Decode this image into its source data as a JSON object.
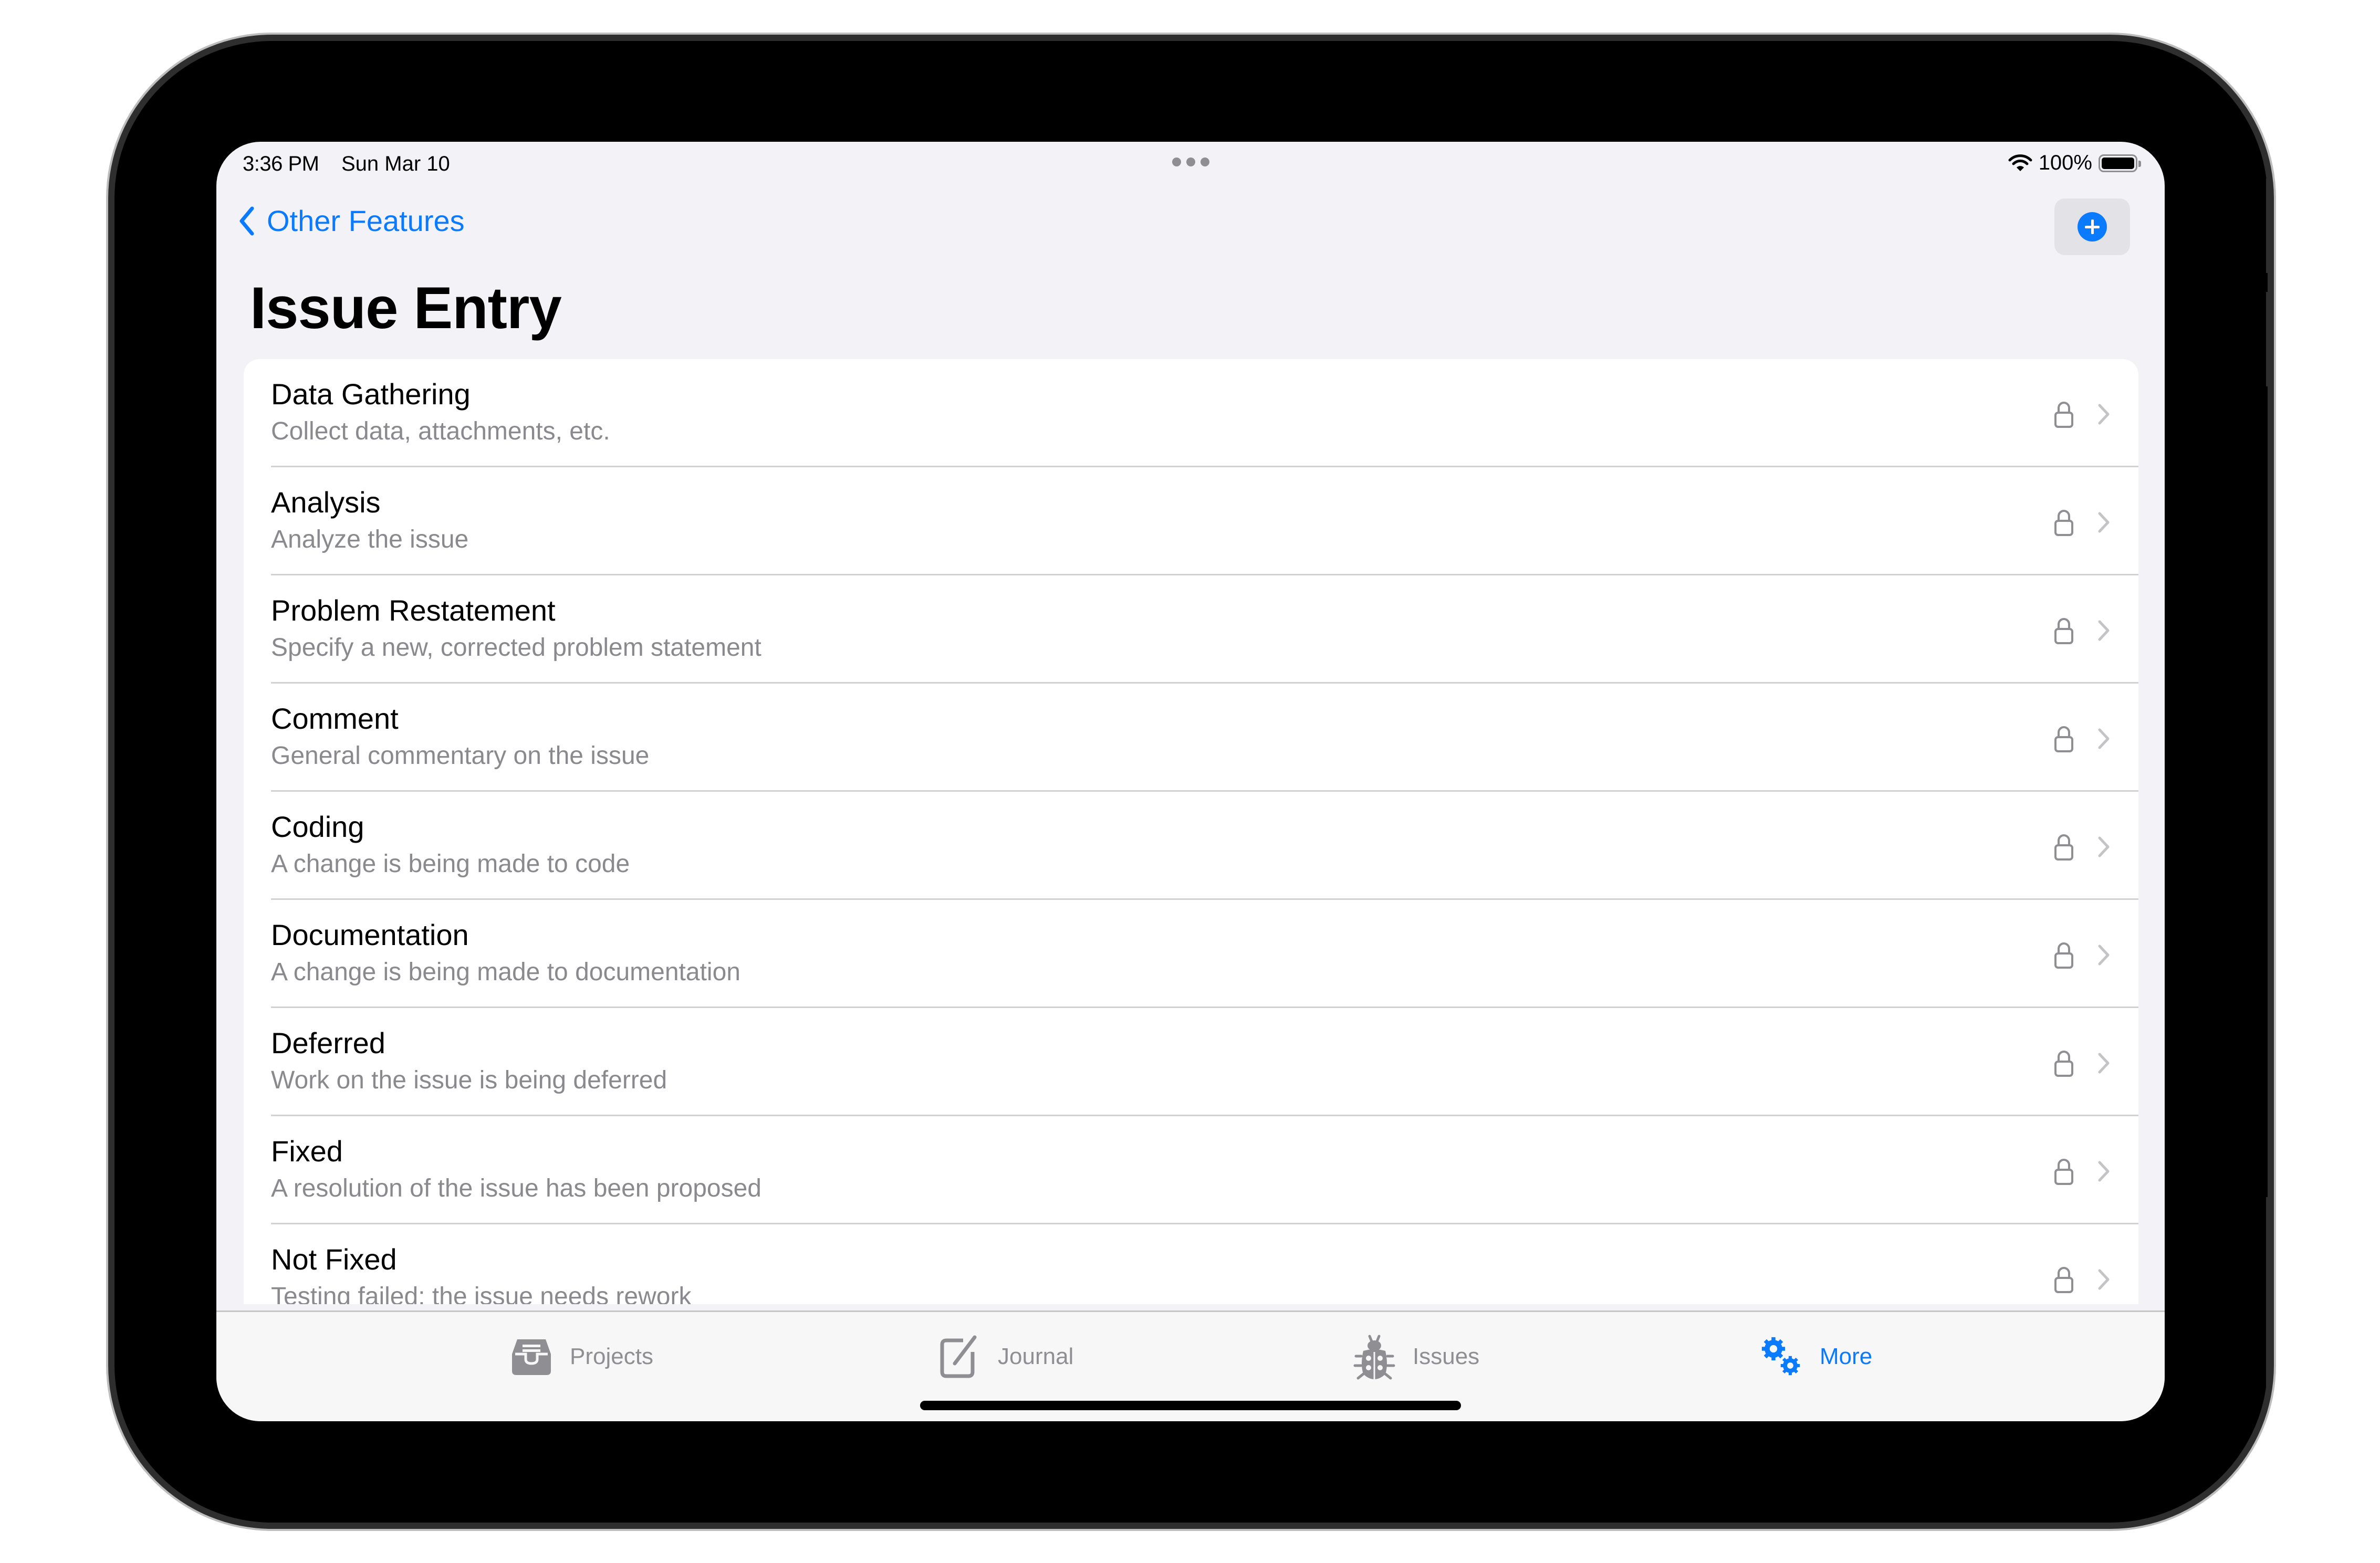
{
  "status_bar": {
    "time": "3:36 PM",
    "date": "Sun Mar 10",
    "battery_percent": "100%",
    "battery_level": 1.0
  },
  "navigation": {
    "back_label": "Other Features",
    "title": "Issue Entry",
    "add_button_icon": "plus-circle-fill-icon"
  },
  "colors": {
    "accent": "#0a7aff",
    "background": "#f2f2f7",
    "secondary_text": "#8a8a8e",
    "inactive_tab": "#8e8e93"
  },
  "entries": [
    {
      "title": "Data Gathering",
      "subtitle": "Collect data, attachments, etc.",
      "locked": true
    },
    {
      "title": "Analysis",
      "subtitle": "Analyze the issue",
      "locked": true
    },
    {
      "title": "Problem Restatement",
      "subtitle": "Specify a new, corrected problem statement",
      "locked": true
    },
    {
      "title": "Comment",
      "subtitle": "General commentary on the issue",
      "locked": true
    },
    {
      "title": "Coding",
      "subtitle": "A change is being made to code",
      "locked": true
    },
    {
      "title": "Documentation",
      "subtitle": "A change is being made to documentation",
      "locked": true
    },
    {
      "title": "Deferred",
      "subtitle": "Work on the issue is being deferred",
      "locked": true
    },
    {
      "title": "Fixed",
      "subtitle": "A resolution of the issue has been proposed",
      "locked": true
    },
    {
      "title": "Not Fixed",
      "subtitle": "Testing failed; the issue needs rework",
      "locked": true
    }
  ],
  "tab_bar": {
    "tabs": [
      {
        "label": "Projects",
        "icon": "tray-icon",
        "active": false
      },
      {
        "label": "Journal",
        "icon": "square-pencil-icon",
        "active": false
      },
      {
        "label": "Issues",
        "icon": "ladybug-icon",
        "active": false
      },
      {
        "label": "More",
        "icon": "gears-icon",
        "active": true
      }
    ]
  }
}
